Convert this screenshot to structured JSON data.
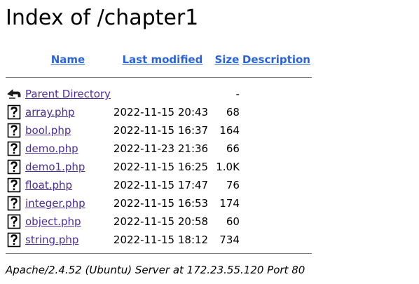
{
  "page": {
    "title": "Index of /chapter1"
  },
  "columns": {
    "name": "Name",
    "last_modified": "Last modified",
    "size": "Size",
    "description": "Description"
  },
  "parent": {
    "label": "Parent Directory",
    "size": "-",
    "icon": "back-arrow-icon"
  },
  "files": [
    {
      "name": "array.php",
      "modified": "2022-11-15 20:43",
      "size": "68",
      "icon": "unknown-file-icon"
    },
    {
      "name": "bool.php",
      "modified": "2022-11-15 16:37",
      "size": "164",
      "icon": "unknown-file-icon"
    },
    {
      "name": "demo.php",
      "modified": "2022-11-23 21:36",
      "size": "66",
      "icon": "unknown-file-icon"
    },
    {
      "name": "demo1.php",
      "modified": "2022-11-15 16:25",
      "size": "1.0K",
      "icon": "unknown-file-icon"
    },
    {
      "name": "float.php",
      "modified": "2022-11-15 17:47",
      "size": "76",
      "icon": "unknown-file-icon"
    },
    {
      "name": "integer.php",
      "modified": "2022-11-15 16:53",
      "size": "174",
      "icon": "unknown-file-icon"
    },
    {
      "name": "object.php",
      "modified": "2022-11-15 20:58",
      "size": "60",
      "icon": "unknown-file-icon"
    },
    {
      "name": "string.php",
      "modified": "2022-11-15 18:12",
      "size": "734",
      "icon": "unknown-file-icon"
    }
  ],
  "footer": {
    "address": "Apache/2.4.52 (Ubuntu) Server at 172.23.55.120 Port 80"
  },
  "colors": {
    "header_link": "#2a63d6",
    "file_link": "#4b2d9b",
    "separator": "#7a7a7a"
  }
}
